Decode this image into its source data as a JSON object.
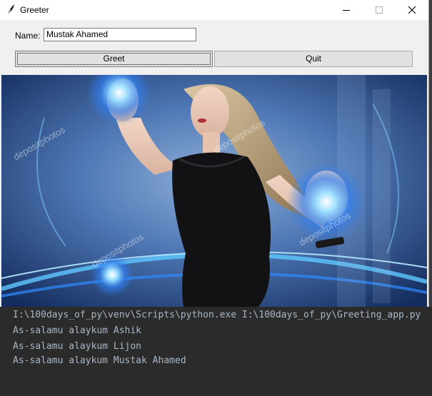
{
  "window": {
    "title": "Greeter",
    "icon": "feather-icon",
    "controls": [
      "minimize-icon",
      "maximize-icon",
      "close-icon"
    ]
  },
  "form": {
    "name_label": "Name:",
    "name_value": "Mustak Ahamed"
  },
  "buttons": {
    "greet": "Greet",
    "quit": "Quit"
  },
  "image": {
    "watermark": "depositphotos"
  },
  "terminal": {
    "command": "I:\\100days_of_py\\venv\\Scripts\\python.exe I:\\100days_of_py\\Greeting_app.py",
    "lines": [
      "As-salamu alaykum Ashik",
      "As-salamu alaykum Lijon",
      "As-salamu alaykum Mustak Ahamed"
    ]
  },
  "colors": {
    "terminal_bg": "#2b2b2b",
    "terminal_text": "#a9b7c6",
    "window_bg": "#f0f0f0"
  }
}
